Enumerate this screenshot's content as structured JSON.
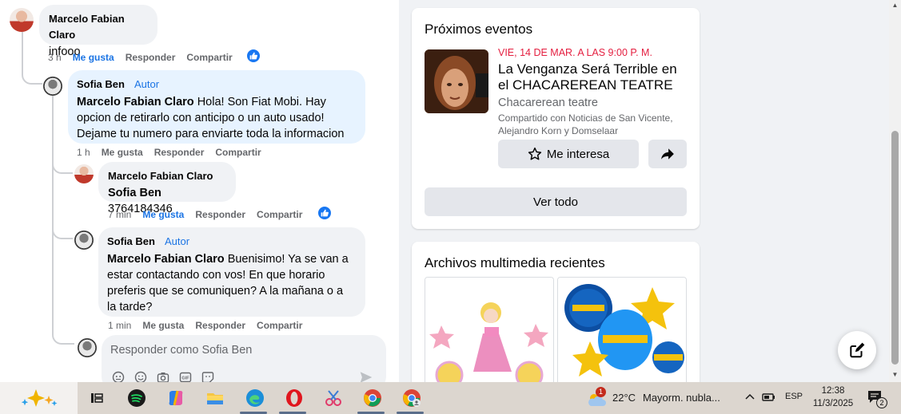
{
  "comments": [
    {
      "author": "Marcelo Fabian Claro",
      "text": "infooo",
      "time": "3 h",
      "like": "Me gusta",
      "reply": "Responder",
      "share": "Compartir"
    },
    {
      "author": "Sofia Ben",
      "badge": "Autor",
      "mention": "Marcelo Fabian Claro",
      "text_lines": [
        "Hola! Son Fiat Mobi. Hay",
        "opcion de retirarlo con anticipo o un auto usado!",
        "Dejame tu numero para enviarte toda la informacion"
      ],
      "time": "1 h",
      "like": "Me gusta",
      "reply": "Responder",
      "share": "Compartir"
    },
    {
      "author": "Marcelo Fabian Claro",
      "mention": "Sofia Ben",
      "text": "3764184346",
      "time": "7 min",
      "like": "Me gusta",
      "reply": "Responder",
      "share": "Compartir"
    },
    {
      "author": "Sofia Ben",
      "badge": "Autor",
      "mention": "Marcelo Fabian Claro",
      "text_lines": [
        "Buenisimo! Ya se van a",
        "estar contactando con vos! En que horario",
        "preferis que se comuniquen? A la mañana o a",
        "la tarde?"
      ],
      "time": "1 min",
      "like": "Me gusta",
      "reply": "Responder",
      "share": "Compartir"
    }
  ],
  "reply_box": {
    "placeholder": "Responder como Sofia Ben",
    "icons": [
      "sticker-icon",
      "emoji-icon",
      "camera-icon",
      "gif-icon",
      "avatar-sticker-icon",
      "send-icon"
    ]
  },
  "events": {
    "title": "Próximos eventos",
    "date": "VIE, 14 DE MAR. A LAS 9:00 P. M.",
    "event_name_lines": [
      "La Venganza Será Terrible en",
      "el CHACAREREAN TEATRE"
    ],
    "place": "Chacarerean teatre",
    "shared_lines": [
      "Compartido con Noticias de San Vicente,",
      "Alejandro Korn y Domselaar"
    ],
    "interest_label": "Me interesa",
    "see_all_label": "Ver todo"
  },
  "media": {
    "title": "Archivos multimedia recientes"
  },
  "taskbar": {
    "weather_badge": "1",
    "temperature": "22°C",
    "weather_text": "Mayorm. nubla...",
    "language": "ESP",
    "time": "12:38",
    "date": "11/3/2025",
    "notifications": "2"
  },
  "colors": {
    "accent": "#1b74e4",
    "date_red": "#e41e3f",
    "author_bubble": "#e7f3ff",
    "bubble": "#f0f2f5"
  }
}
